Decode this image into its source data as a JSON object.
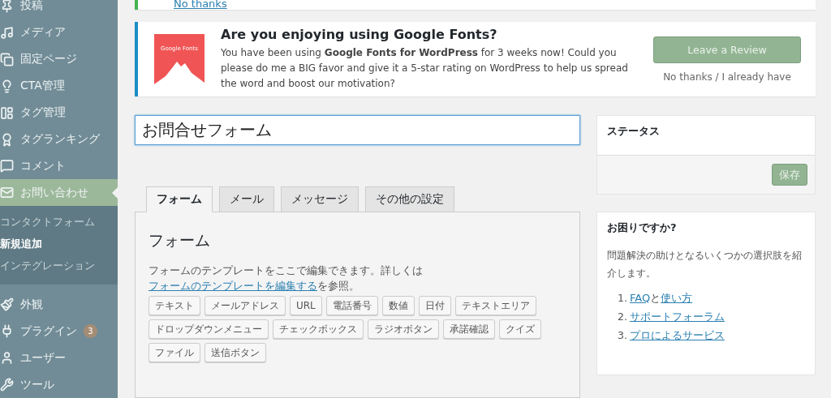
{
  "sidebar": {
    "items": [
      {
        "label": "投稿",
        "selected": false
      },
      {
        "label": "メディア",
        "selected": false
      },
      {
        "label": "固定ページ",
        "selected": false
      },
      {
        "label": "CTA管理",
        "selected": false
      },
      {
        "label": "タグ管理",
        "selected": false
      },
      {
        "label": "タグランキング",
        "selected": false
      },
      {
        "label": "コメント",
        "selected": false
      },
      {
        "label": "お問い合わせ",
        "selected": true,
        "children": [
          {
            "label": "コンタクトフォーム",
            "selected": false
          },
          {
            "label": "新規追加",
            "selected": true
          },
          {
            "label": "インテグレーション",
            "selected": false
          }
        ]
      },
      {
        "label": "外観",
        "selected": false
      },
      {
        "label": "プラグイン",
        "selected": false,
        "badge": "3"
      },
      {
        "label": "ユーザー",
        "selected": false
      },
      {
        "label": "ツール",
        "selected": false
      }
    ]
  },
  "top_notice": {
    "link": "No thanks"
  },
  "review_notice": {
    "logo_text": "Google Fonts",
    "title": "Are you enjoying using Google Fonts?",
    "body": "You have been using **Google Fonts for WordPress** for 3 weeks now! Could you please do me a BIG favor and give it a 5-star rating on WordPress to help us spread the word and boost our motivation?",
    "button": "Leave a Review",
    "dismiss": "No thanks / I already have"
  },
  "title_field": {
    "value": "お問合せフォーム"
  },
  "tabs": [
    {
      "label": "フォーム",
      "selected": true
    },
    {
      "label": "メール",
      "selected": false
    },
    {
      "label": "メッセージ",
      "selected": false
    },
    {
      "label": "その他の設定",
      "selected": false
    }
  ],
  "panel": {
    "heading": "フォーム",
    "text_before": "フォームのテンプレートをここで編集できます。詳しくは",
    "link": "フォームのテンプレートを編集する",
    "text_after": "を参照。",
    "tag_buttons": [
      "テキスト",
      "メールアドレス",
      "URL",
      "電話番号",
      "数値",
      "日付",
      "テキストエリア",
      "ドロップダウンメニュー",
      "チェックボックス",
      "ラジオボタン",
      "承諾確認",
      "クイズ",
      "ファイル",
      "送信ボタン"
    ]
  },
  "status_box": {
    "title": "ステータス",
    "save_button": "保存"
  },
  "help_box": {
    "title": "お困りですか?",
    "text": "問題解決の助けとなるいくつかの選択肢を紹介します。",
    "items": [
      {
        "number": "1.",
        "segments": [
          {
            "text": "FAQ",
            "link": true
          },
          {
            "text": "と",
            "link": false
          },
          {
            "text": "使い方",
            "link": true
          }
        ]
      },
      {
        "number": "2.",
        "segments": [
          {
            "text": "サポートフォーラム",
            "link": true
          }
        ]
      },
      {
        "number": "3.",
        "segments": [
          {
            "text": "プロによるサービス",
            "link": true
          }
        ]
      }
    ]
  }
}
